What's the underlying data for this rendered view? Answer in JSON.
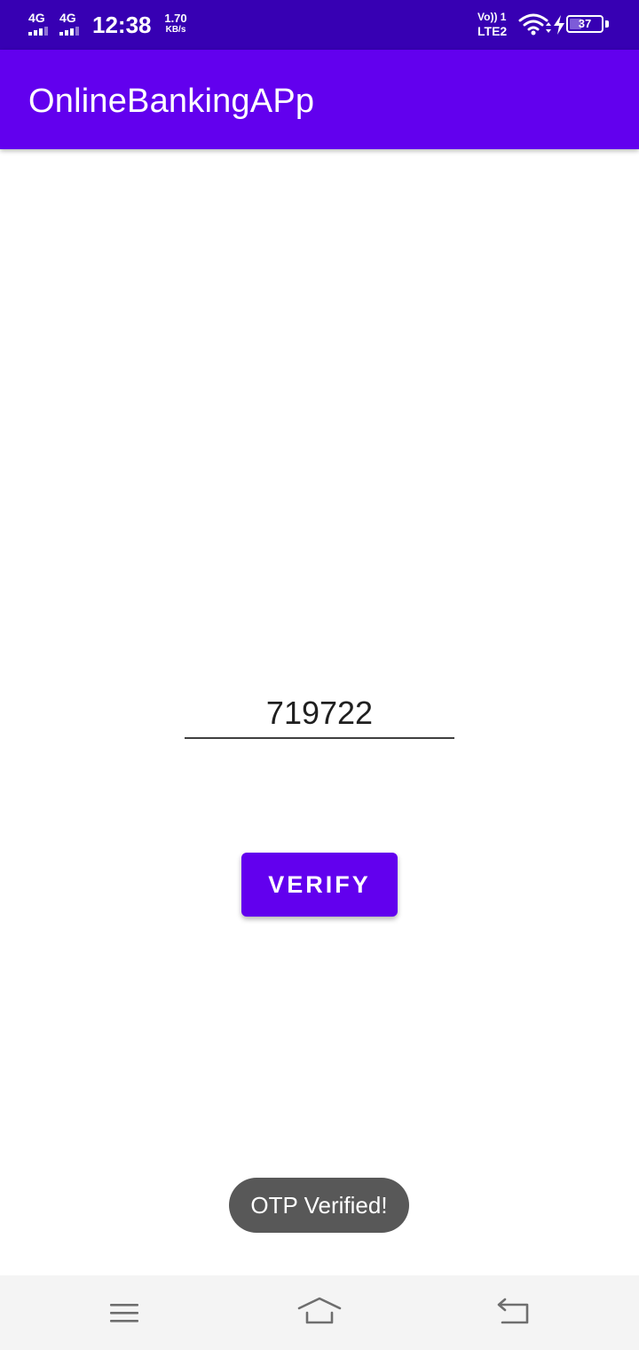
{
  "status_bar": {
    "sim1_network": "4G",
    "sim2_network": "4G",
    "time": "12:38",
    "speed_value": "1.70",
    "speed_unit": "KB/s",
    "volte_line1": "Vo)) 1",
    "volte_line2": "LTE2",
    "battery_level": "37",
    "battery_fraction": 0.37
  },
  "app_bar": {
    "title": "OnlineBankingAPp"
  },
  "otp": {
    "value": "719722"
  },
  "verify_button": {
    "label": "VERIFY"
  },
  "toast": {
    "message": "OTP Verified!"
  },
  "nav_bar": {
    "menu_icon": "menu-icon",
    "home_icon": "home-icon",
    "back_icon": "back-icon"
  },
  "colors": {
    "status_bar": "#3700b3",
    "primary": "#6200ee",
    "toast_bg": "#585858",
    "nav_bg": "#f4f4f4"
  }
}
